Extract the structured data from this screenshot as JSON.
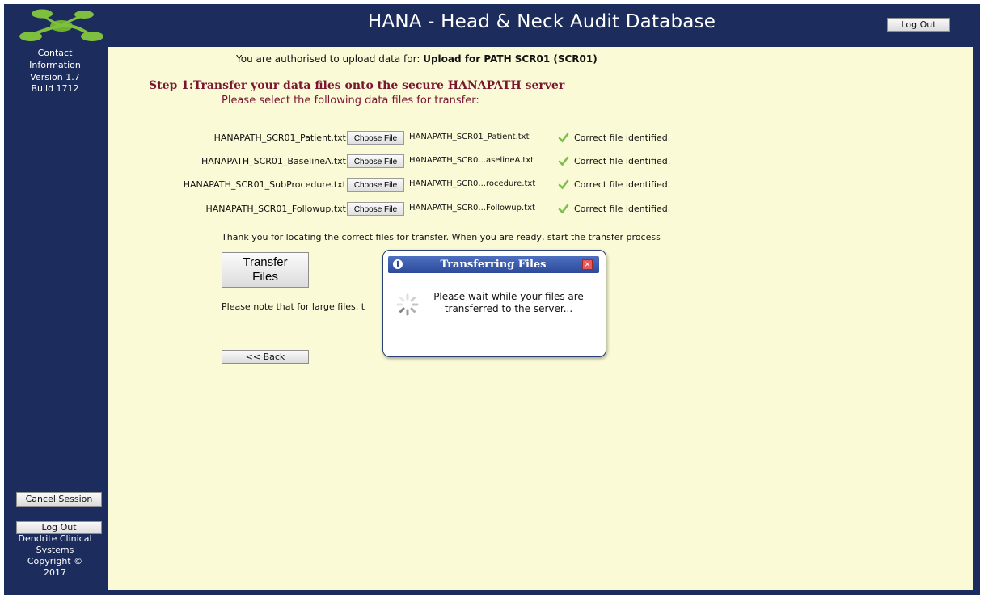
{
  "header": {
    "title": "HANA - Head & Neck Audit Database",
    "logout_label": "Log Out"
  },
  "sidebar": {
    "contact_line1": "Contact",
    "contact_line2": "Information",
    "version": "Version 1.7",
    "build": "Build 1712",
    "cancel_label": "Cancel Session",
    "logout_label": "Log Out",
    "copyright_lines": [
      "Dendrite Clinical",
      "Systems",
      "Copyright ©",
      "2017"
    ]
  },
  "main": {
    "auth_prefix": "You are authorised to upload data for:",
    "auth_target": "Upload for PATH SCR01 (SCR01)",
    "step_title": "Step 1:Transfer your data files onto the secure HANAPATH server",
    "step_subtitle": "Please select the following data files for transfer:",
    "choose_label": "Choose File",
    "files": [
      {
        "label": "HANAPATH_SCR01_Patient.txt",
        "chosen": "HANAPATH_SCR01_Patient.txt",
        "status": "Correct file identified."
      },
      {
        "label": "HANAPATH_SCR01_BaselineA.txt",
        "chosen": "HANAPATH_SCR0...aselineA.txt",
        "status": "Correct file identified."
      },
      {
        "label": "HANAPATH_SCR01_SubProcedure.txt",
        "chosen": "HANAPATH_SCR0...rocedure.txt",
        "status": "Correct file identified."
      },
      {
        "label": "HANAPATH_SCR01_Followup.txt",
        "chosen": "HANAPATH_SCR0...Followup.txt",
        "status": "Correct file identified."
      }
    ],
    "thanks": "Thank you for locating the correct files for transfer. When you are ready, start the transfer process",
    "transfer_line1": "Transfer",
    "transfer_line2": "Files",
    "note": "Please note that for large files, t",
    "back_label": "<< Back"
  },
  "dialog": {
    "title": "Transferring Files",
    "message_line1": "Please wait while your files are",
    "message_line2": "transferred to the server...",
    "close_glyph": "×"
  },
  "colors": {
    "frame": "#1c2c5c",
    "content_bg": "#fafad6",
    "step_title": "#7a1530",
    "check": "#7dbf4a",
    "dialog_bar": "#2b4a9a"
  }
}
